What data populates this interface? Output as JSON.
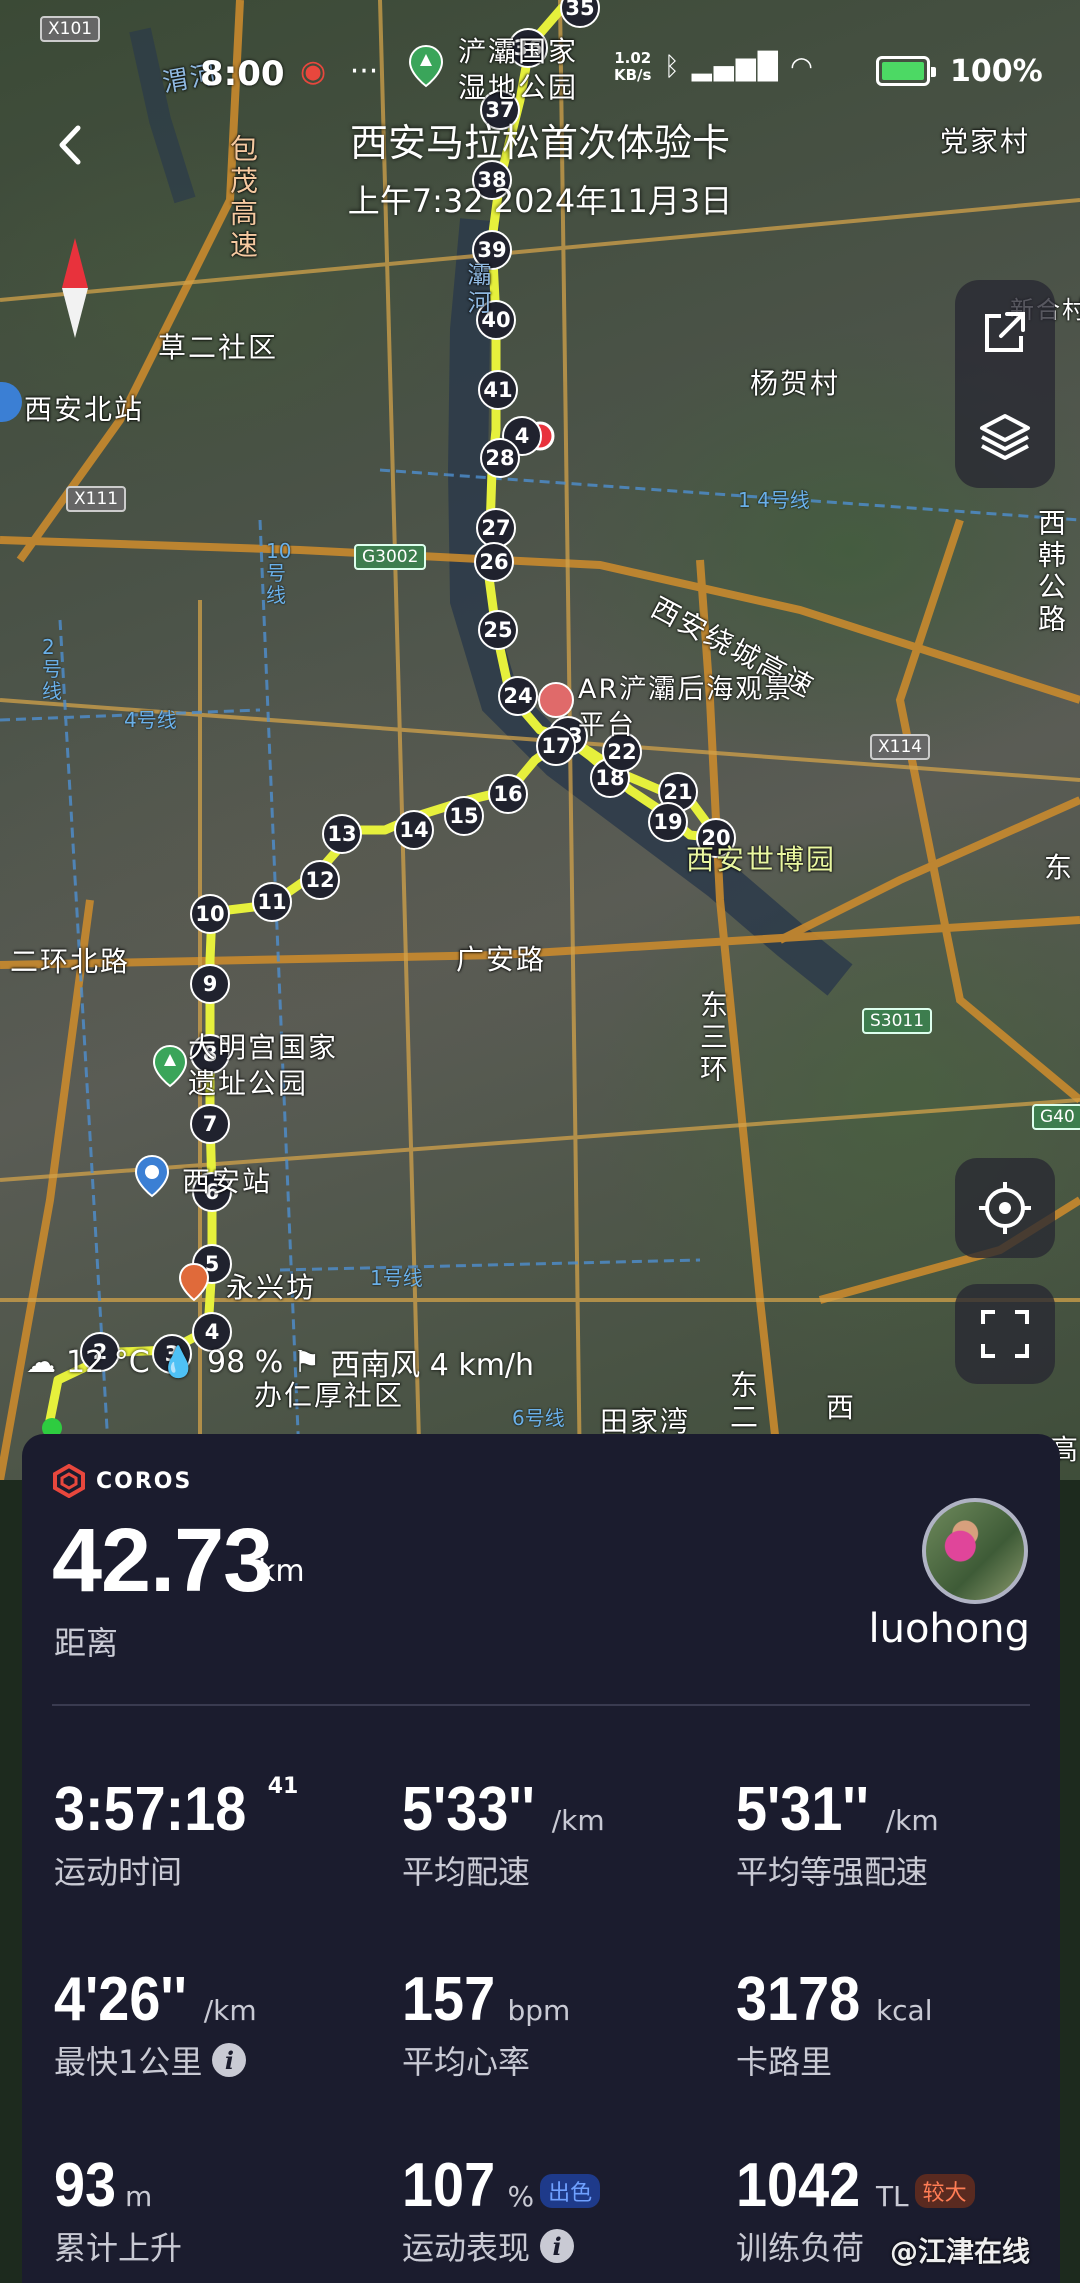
{
  "status_bar": {
    "time": "8:00",
    "net_speed": "1.02",
    "net_unit": "KB/s",
    "battery_percent": "100%",
    "battery_level": 1.0
  },
  "header": {
    "title": "西安马拉松首次体验卡",
    "subtitle": "上午7:32 2024年11月3日"
  },
  "map": {
    "labels": {
      "chanba_wetland": "浐灞国家湿地公园",
      "dangjiacun": "党家村",
      "baomao": "包茂高速",
      "caoer": "草二社区",
      "xianbei": "西安北站",
      "yanghecun": "杨贺村",
      "xinhecun": "新合村",
      "xihan": "西韩公路",
      "ring_expressway": "西安绕城高速",
      "haiguan": "AR浐灞后海观景平台",
      "expo": "西安世博园",
      "erhuan_north": "二环北路",
      "guangan": "广安路",
      "daming": "大明宫国家遗址公园",
      "xian_station": "西安站",
      "yongxing": "永兴坊",
      "east_third_ring": "东三环",
      "renhou": "办仁厚社区",
      "tianjiawan": "田家湾",
      "bahe": "灞河",
      "weihe": "渭河",
      "dongsanhuan_short": "东二",
      "xi": "西",
      "gao": "高",
      "dong": "东"
    },
    "road_badges": [
      "X101",
      "X111",
      "G3002",
      "X114",
      "S3011",
      "G40"
    ],
    "metro_lines": [
      "1 4号线",
      "10号线",
      "2号线",
      "4号线",
      "1号线",
      "6号线"
    ],
    "km_markers": [
      "35",
      "36",
      "37",
      "38",
      "39",
      "40",
      "41",
      "4",
      "28",
      "27",
      "26",
      "25",
      "24",
      "23",
      "17",
      "18",
      "22",
      "21",
      "19",
      "20",
      "16",
      "15",
      "14",
      "13",
      "12",
      "11",
      "10",
      "9",
      "8",
      "7",
      "6",
      "5",
      "4",
      "3",
      "2"
    ]
  },
  "weather": {
    "temperature": "12 °C",
    "humidity": "98 %",
    "wind": "西南风 4 km/h"
  },
  "card": {
    "brand": "COROS",
    "distance": "42.73",
    "distance_unit": "km",
    "distance_label": "距离",
    "username": "luohong",
    "stats": [
      {
        "value": "3:57:18",
        "sup": "41",
        "unit": "",
        "label": "运动时间"
      },
      {
        "value": "5'33''",
        "unit": "/km",
        "label": "平均配速"
      },
      {
        "value": "5'31''",
        "unit": "/km",
        "label": "平均等强配速"
      },
      {
        "value": "4'26''",
        "unit": "/km",
        "label": "最快1公里"
      },
      {
        "value": "157",
        "unit": "bpm",
        "label": "平均心率"
      },
      {
        "value": "3178",
        "unit": "kcal",
        "label": "卡路里"
      },
      {
        "value": "93",
        "unit": "m",
        "label": "累计上升"
      },
      {
        "value": "107",
        "unit": "%",
        "label": "运动表现",
        "badge": "出色"
      },
      {
        "value": "1042",
        "unit": "TL",
        "label": "训练负荷",
        "badge": "较大"
      }
    ]
  },
  "watermark": "@江津在线",
  "colors": {
    "route": "#e6f03c",
    "card_bg": "#1b1c2e",
    "brand_red": "#e8473d",
    "badge_blue": "#6fa0ff",
    "badge_orange": "#ff7d55"
  }
}
